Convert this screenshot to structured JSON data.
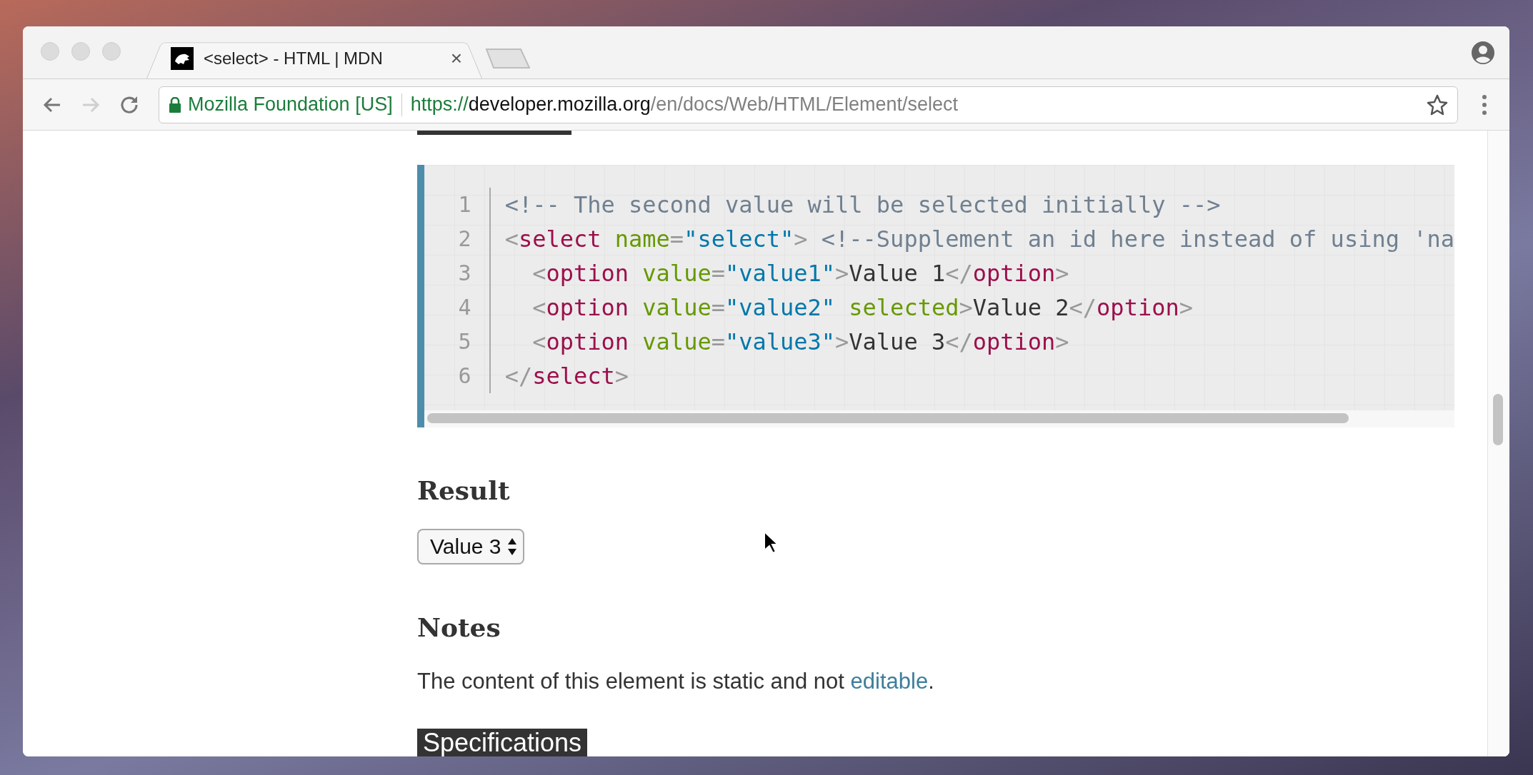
{
  "browser": {
    "tab": {
      "title": "<select> - HTML | MDN",
      "selected": true,
      "close_glyph": "×"
    },
    "address_bar": {
      "site_identity": "Mozilla Foundation [US]",
      "url_scheme": "https://",
      "url_host": "developer.mozilla.org",
      "url_path": "/en/docs/Web/HTML/Element/select"
    }
  },
  "code_example": {
    "lines": [
      {
        "number": "1",
        "tokens": [
          {
            "kind": "comment",
            "text": "<!-- The second value will be selected initially -->"
          }
        ]
      },
      {
        "number": "2",
        "tokens": [
          {
            "kind": "punct",
            "text": "<"
          },
          {
            "kind": "tag",
            "text": "select"
          },
          {
            "kind": "attr",
            "text": " name"
          },
          {
            "kind": "punct",
            "text": "="
          },
          {
            "kind": "string",
            "text": "\"select\""
          },
          {
            "kind": "punct",
            "text": ">"
          },
          {
            "kind": "comment",
            "text": " <!--Supplement an id here instead of using 'na"
          }
        ]
      },
      {
        "number": "3",
        "tokens": [
          {
            "kind": "punct",
            "text": "  <"
          },
          {
            "kind": "tag",
            "text": "option"
          },
          {
            "kind": "attr",
            "text": " value"
          },
          {
            "kind": "punct",
            "text": "="
          },
          {
            "kind": "string",
            "text": "\"value1\""
          },
          {
            "kind": "punct",
            "text": ">"
          },
          {
            "kind": "text",
            "text": "Value 1"
          },
          {
            "kind": "punct",
            "text": "</"
          },
          {
            "kind": "tag",
            "text": "option"
          },
          {
            "kind": "punct",
            "text": ">"
          }
        ]
      },
      {
        "number": "4",
        "tokens": [
          {
            "kind": "punct",
            "text": "  <"
          },
          {
            "kind": "tag",
            "text": "option"
          },
          {
            "kind": "attr",
            "text": " value"
          },
          {
            "kind": "punct",
            "text": "="
          },
          {
            "kind": "string",
            "text": "\"value2\""
          },
          {
            "kind": "attr",
            "text": " selected"
          },
          {
            "kind": "punct",
            "text": ">"
          },
          {
            "kind": "text",
            "text": "Value 2"
          },
          {
            "kind": "punct",
            "text": "</"
          },
          {
            "kind": "tag",
            "text": "option"
          },
          {
            "kind": "punct",
            "text": ">"
          }
        ]
      },
      {
        "number": "5",
        "tokens": [
          {
            "kind": "punct",
            "text": "  <"
          },
          {
            "kind": "tag",
            "text": "option"
          },
          {
            "kind": "attr",
            "text": " value"
          },
          {
            "kind": "punct",
            "text": "="
          },
          {
            "kind": "string",
            "text": "\"value3\""
          },
          {
            "kind": "punct",
            "text": ">"
          },
          {
            "kind": "text",
            "text": "Value 3"
          },
          {
            "kind": "punct",
            "text": "</"
          },
          {
            "kind": "tag",
            "text": "option"
          },
          {
            "kind": "punct",
            "text": ">"
          }
        ]
      },
      {
        "number": "6",
        "tokens": [
          {
            "kind": "punct",
            "text": "</"
          },
          {
            "kind": "tag",
            "text": "select"
          },
          {
            "kind": "punct",
            "text": ">"
          }
        ]
      }
    ]
  },
  "result": {
    "heading": "Result",
    "select_value": "Value 3"
  },
  "notes": {
    "heading": "Notes",
    "text_before": "The content of this element is static and not ",
    "link": "editable",
    "text_after": "."
  },
  "specifications": {
    "heading": "Specifications"
  }
}
